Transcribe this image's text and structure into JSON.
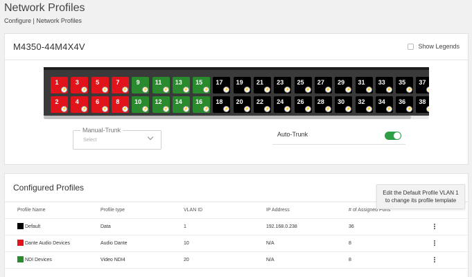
{
  "header": {
    "title": "Network Profiles",
    "breadcrumb": "Configure | Network Profiles"
  },
  "switch": {
    "model": "M4350-44M4X4V",
    "show_legends_label": "Show Legends",
    "ports_top": [
      {
        "label": "1",
        "color": "#e0141a"
      },
      {
        "label": "3",
        "color": "#e0141a"
      },
      {
        "label": "5",
        "color": "#e0141a"
      },
      {
        "label": "7",
        "color": "#e0141a"
      },
      {
        "label": "9",
        "color": "#2a8a2e"
      },
      {
        "label": "11",
        "color": "#2a8a2e"
      },
      {
        "label": "13",
        "color": "#2a8a2e"
      },
      {
        "label": "15",
        "color": "#2a8a2e"
      },
      {
        "label": "17",
        "color": "#000000"
      },
      {
        "label": "19",
        "color": "#000000"
      },
      {
        "label": "21",
        "color": "#000000"
      },
      {
        "label": "23",
        "color": "#000000"
      },
      {
        "label": "25",
        "color": "#000000"
      },
      {
        "label": "27",
        "color": "#000000"
      },
      {
        "label": "29",
        "color": "#000000"
      },
      {
        "label": "31",
        "color": "#000000"
      },
      {
        "label": "33",
        "color": "#000000"
      },
      {
        "label": "35",
        "color": "#000000"
      },
      {
        "label": "37",
        "color": "#000000"
      }
    ],
    "ports_bottom": [
      {
        "label": "2",
        "color": "#e0141a"
      },
      {
        "label": "4",
        "color": "#e0141a"
      },
      {
        "label": "6",
        "color": "#e0141a"
      },
      {
        "label": "8",
        "color": "#e0141a"
      },
      {
        "label": "10",
        "color": "#2a8a2e"
      },
      {
        "label": "12",
        "color": "#2a8a2e"
      },
      {
        "label": "14",
        "color": "#2a8a2e"
      },
      {
        "label": "16",
        "color": "#2a8a2e"
      },
      {
        "label": "18",
        "color": "#000000"
      },
      {
        "label": "20",
        "color": "#000000"
      },
      {
        "label": "22",
        "color": "#000000"
      },
      {
        "label": "24",
        "color": "#000000"
      },
      {
        "label": "26",
        "color": "#000000"
      },
      {
        "label": "28",
        "color": "#000000"
      },
      {
        "label": "30",
        "color": "#000000"
      },
      {
        "label": "32",
        "color": "#000000"
      },
      {
        "label": "34",
        "color": "#000000"
      },
      {
        "label": "36",
        "color": "#000000"
      },
      {
        "label": "38",
        "color": "#000000"
      }
    ],
    "port_badge_icon": "lightning-icon",
    "manual_trunk_label": "Manual-Trunk",
    "manual_trunk_placeholder": "Select",
    "auto_trunk_label": "Auto-Trunk",
    "auto_trunk_enabled": true
  },
  "profiles": {
    "title": "Configured Profiles",
    "tooltip_line1": "Edit the Default Profile VLAN 1",
    "tooltip_line2": "to change its profile template",
    "columns": [
      "Profile Name",
      "Profile type",
      "VLAN ID",
      "IP Address",
      "# of Assigned Ports"
    ],
    "rows": [
      {
        "name": "Default",
        "color": "#000000",
        "type": "Data",
        "vlan": "1",
        "ip": "192.168.0.238",
        "ports": "36"
      },
      {
        "name": "Dante Audio Devices",
        "color": "#e0141a",
        "type": "Audio Dante",
        "vlan": "10",
        "ip": "N/A",
        "ports": "8"
      },
      {
        "name": "NDI Devices",
        "color": "#2a8a2e",
        "type": "Video NDI4",
        "vlan": "20",
        "ip": "N/A",
        "ports": "8"
      }
    ]
  }
}
